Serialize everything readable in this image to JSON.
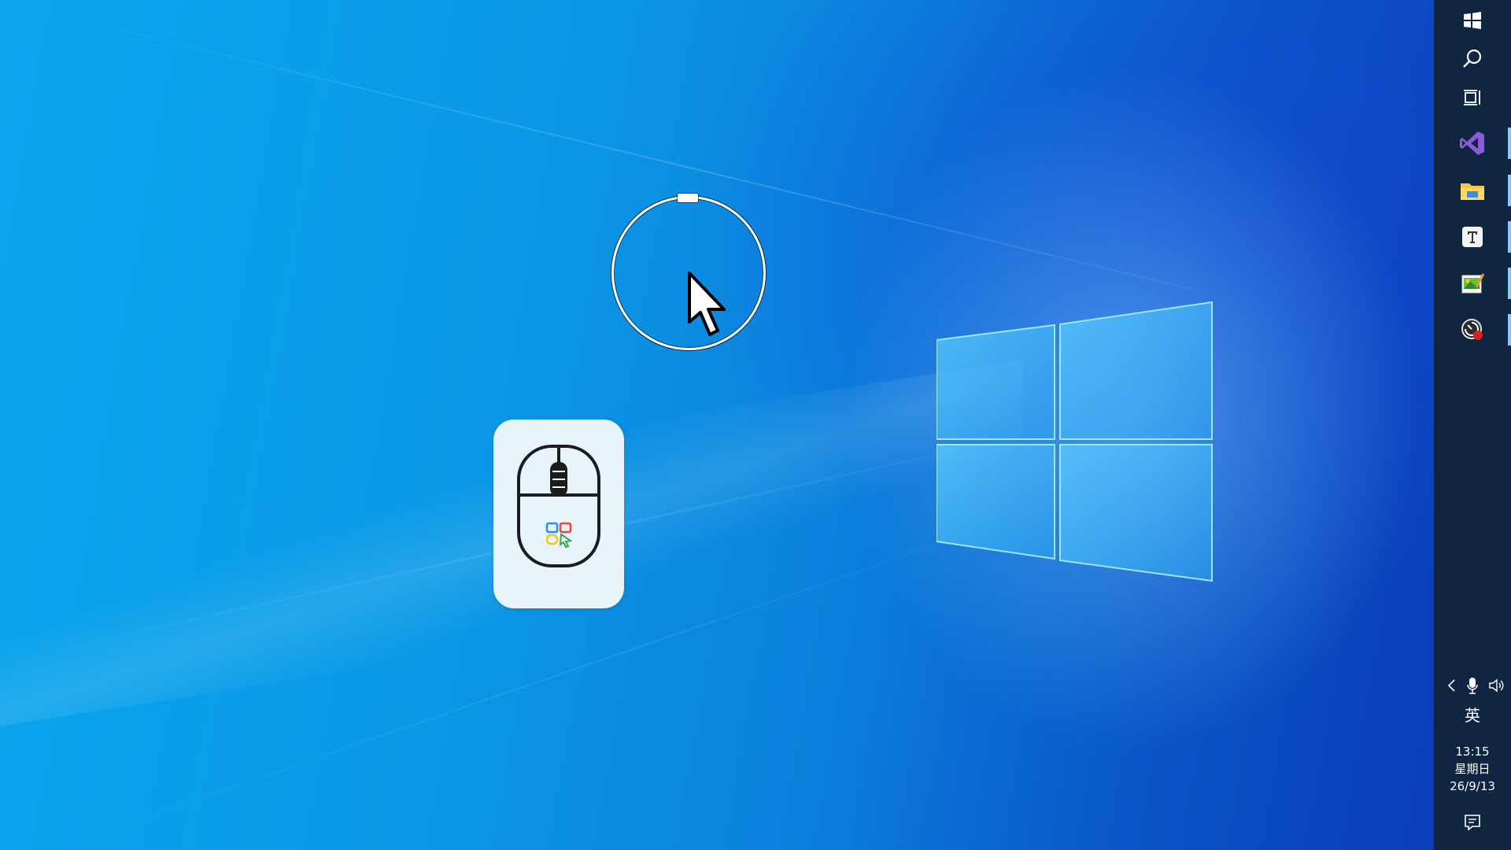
{
  "desktop": {
    "wallpaper": "Windows 10 light logo wallpaper",
    "colors": {
      "base": "#0a9ae8",
      "deep": "#0a3db8",
      "logo_glow": "#7fd8ff"
    }
  },
  "overlay": {
    "circle_cursor": "ring-cursor-highlight",
    "pointer": "arrow-cursor-icon"
  },
  "app_tile": {
    "icon": "mouse-icon",
    "colors": {
      "tile": "#e8f4fa",
      "blue": "#2a8ee8",
      "red": "#e8463a",
      "yellow": "#f5c518",
      "green": "#32a852"
    }
  },
  "taskbar": {
    "color": "#0f2540",
    "buttons": [
      {
        "icon": "windows-start-icon"
      },
      {
        "icon": "search-icon"
      },
      {
        "icon": "task-view-icon"
      },
      {
        "icon": "visual-studio-icon"
      },
      {
        "icon": "file-explorer-icon"
      },
      {
        "icon": "text-editor-icon"
      },
      {
        "icon": "image-editor-icon"
      },
      {
        "icon": "screen-recorder-icon"
      }
    ],
    "tray": {
      "icons": [
        "chevron-left-icon",
        "microphone-icon",
        "speaker-icon"
      ],
      "ime": "英",
      "time": "13:15",
      "weekday": "星期日",
      "date": "26/9/13",
      "notification_icon": "action-center-icon"
    }
  }
}
